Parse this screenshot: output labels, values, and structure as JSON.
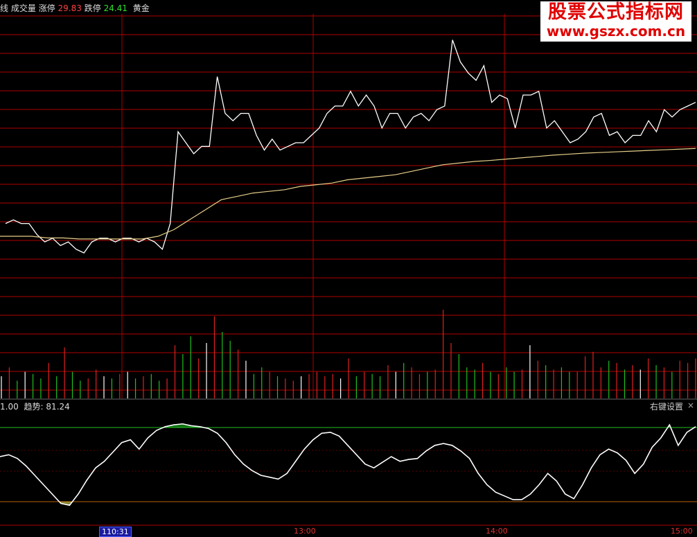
{
  "header": {
    "prefix": "线",
    "volume_label": "成交量",
    "limit_up_label": "涨停",
    "limit_up_value": "29.83",
    "limit_down_label": "跌停",
    "limit_down_value": "24.41",
    "gold_label": "黄金"
  },
  "watermark": {
    "line1": "股票公式指标网",
    "line2": "www.gszx.com.cn"
  },
  "indicator": {
    "prefix": "1.00",
    "label": "趋势:",
    "value": "81.24",
    "settings": "右键设置",
    "close_glyph": "×"
  },
  "x_axis": {
    "labels": [
      "10:31",
      "13:00",
      "14:00",
      "15:00"
    ],
    "selected_prefix": "1"
  },
  "colors": {
    "grid": "#b00000",
    "price": "#ffffff",
    "avg": "#e8d08a",
    "rising_vol": "#e02020",
    "falling_vol": "#20c020",
    "flat_vol": "#ffffff",
    "upper_line": "#22c022",
    "lower_line": "#c06000",
    "green_fill": "#22dd22",
    "yellow_fill": "#ffff66"
  },
  "chart_data": {
    "type": "line",
    "price_series": [
      0.8,
      0.9,
      0.8,
      0.8,
      0.5,
      0.3,
      0.4,
      0.2,
      0.3,
      0.1,
      0.0,
      0.3,
      0.4,
      0.4,
      0.3,
      0.4,
      0.4,
      0.3,
      0.4,
      0.3,
      0.1,
      0.8,
      3.3,
      3.0,
      2.7,
      2.9,
      2.9,
      4.8,
      3.8,
      3.6,
      3.8,
      3.8,
      3.2,
      2.8,
      3.1,
      2.8,
      2.9,
      3.0,
      3.0,
      3.2,
      3.4,
      3.8,
      4.0,
      4.0,
      4.4,
      4.0,
      4.3,
      4.0,
      3.4,
      3.8,
      3.8,
      3.4,
      3.7,
      3.8,
      3.6,
      3.9,
      4.0,
      5.8,
      5.2,
      4.9,
      4.7,
      5.1,
      4.1,
      4.3,
      4.2,
      3.4,
      4.3,
      4.3,
      4.4,
      3.4,
      3.6,
      3.3,
      3.0,
      3.1,
      3.3,
      3.7,
      3.8,
      3.2,
      3.3,
      3.0,
      3.2,
      3.2,
      3.6,
      3.3,
      3.9,
      3.7,
      3.9,
      4.0,
      4.1
    ],
    "avg_series": [
      0.5,
      0.5,
      0.5,
      0.45,
      0.45,
      0.42,
      0.42,
      0.42,
      0.42,
      0.42,
      0.5,
      0.7,
      1.0,
      1.3,
      1.6,
      1.7,
      1.8,
      1.85,
      1.9,
      2.0,
      2.05,
      2.1,
      2.2,
      2.25,
      2.3,
      2.35,
      2.45,
      2.55,
      2.65,
      2.7,
      2.75,
      2.78,
      2.82,
      2.86,
      2.9,
      2.94,
      2.97,
      3.0,
      3.02,
      3.04,
      3.06,
      3.08,
      3.1,
      3.12,
      3.14
    ],
    "volume": [
      10,
      14,
      8,
      12,
      11,
      9,
      16,
      10,
      23,
      12,
      8,
      9,
      13,
      10,
      9,
      11,
      12,
      9,
      10,
      11,
      8,
      9,
      24,
      20,
      28,
      18,
      25,
      37,
      30,
      26,
      22,
      17,
      11,
      14,
      12,
      10,
      9,
      8,
      10,
      11,
      12,
      10,
      11,
      9,
      18,
      10,
      12,
      11,
      10,
      15,
      12,
      16,
      14,
      11,
      12,
      13,
      40,
      25,
      20,
      14,
      13,
      16,
      12,
      11,
      14,
      12,
      13,
      24,
      17,
      15,
      13,
      14,
      12,
      12,
      19,
      21,
      14,
      17,
      16,
      13,
      15,
      13,
      18,
      15,
      14,
      12,
      17,
      16,
      18
    ],
    "trend": [
      60,
      62,
      58,
      50,
      40,
      30,
      20,
      10,
      8,
      20,
      35,
      48,
      55,
      65,
      75,
      78,
      68,
      80,
      88,
      92,
      94,
      95,
      93,
      92,
      90,
      85,
      75,
      62,
      52,
      45,
      40,
      38,
      36,
      42,
      55,
      68,
      78,
      85,
      86,
      82,
      72,
      62,
      52,
      48,
      54,
      60,
      55,
      57,
      58,
      66,
      72,
      74,
      72,
      66,
      58,
      42,
      30,
      22,
      18,
      14,
      14,
      20,
      30,
      42,
      34,
      20,
      15,
      30,
      48,
      62,
      68,
      64,
      56,
      42,
      52,
      70,
      80,
      94,
      72,
      86,
      92
    ]
  }
}
